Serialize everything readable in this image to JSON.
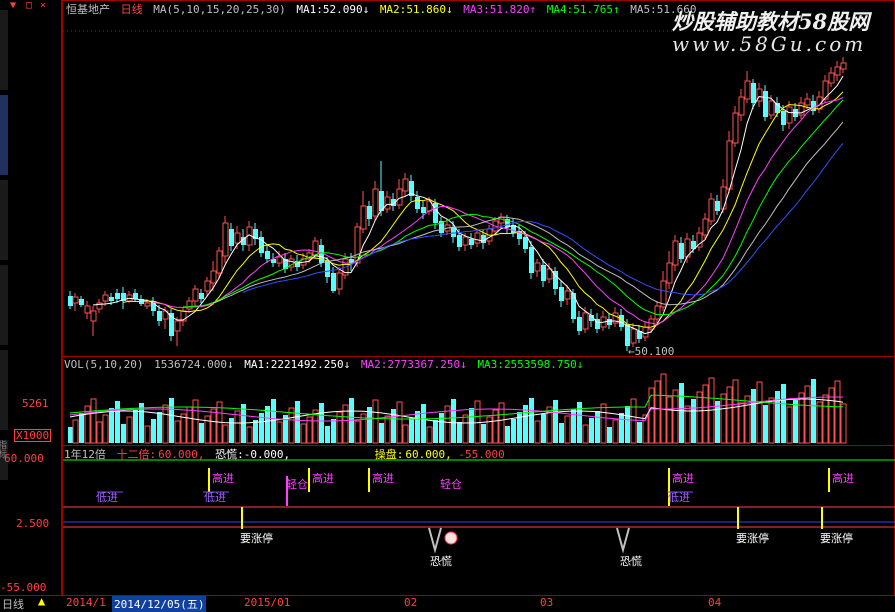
{
  "header": {
    "title": "恒基地产",
    "period": "日线",
    "ma_label": "MA(5,10,15,20,25,30)",
    "ma": [
      {
        "label": "MA1:",
        "value": "52.090↓",
        "color": "#ffffff"
      },
      {
        "label": "MA2:",
        "value": "51.860↓",
        "color": "#ffff00"
      },
      {
        "label": "MA3:",
        "value": "51.820↑",
        "color": "#ff40ff"
      },
      {
        "label": "MA4:",
        "value": "51.765↑",
        "color": "#00ff00"
      },
      {
        "label": "MA5:",
        "value": "51.660",
        "color": "#c0c0c0"
      }
    ]
  },
  "watermark": {
    "line1": "炒股辅助教材58股网",
    "line2": "www.58Gu.com"
  },
  "price_panel": {
    "low_label": "←50.100"
  },
  "vol_panel": {
    "title": "VOL(5,10,20)",
    "vol": "1536724.000↓",
    "ma": [
      {
        "label": "MA1:",
        "value": "2221492.250↓",
        "color": "#ffffff"
      },
      {
        "label": "MA2:",
        "value": "2773367.250↓",
        "color": "#ff40ff"
      },
      {
        "label": "MA3:",
        "value": "2553598.750↓",
        "color": "#00ff00"
      }
    ],
    "axis_value": "5261",
    "axis_unit": "X1000"
  },
  "ind_panel": {
    "title": "1年12倍",
    "f1_label": "十二倍:",
    "f1_value": "60.000,",
    "f2_label": "恐慌:",
    "f2_value": "-0.000,",
    "f3_label": "操盘:",
    "f3_value": "60.000,",
    "f4_value": "-55.000",
    "axis": [
      "60.000",
      "2.500",
      "-55.000"
    ],
    "tags": {
      "gaojin": "高进",
      "zhangting": "要涨停",
      "konghuang": "恐慌",
      "qingcang": "轻仓",
      "dijin": "低进"
    }
  },
  "leftstrip": {
    "ind_label": "指标"
  },
  "statusbar": {
    "period_tab": "日线",
    "ticks": [
      "2014/1",
      "2014/12/05(五)",
      "2015/01",
      "02",
      "03",
      "04"
    ]
  },
  "candles": [
    [
      67,
      295,
      305,
      290,
      308
    ],
    [
      72,
      302,
      296,
      292,
      310
    ],
    [
      78,
      298,
      304,
      295,
      306
    ],
    [
      84,
      312,
      305,
      300,
      318
    ],
    [
      90,
      320,
      310,
      305,
      335
    ],
    [
      96,
      308,
      302,
      298,
      312
    ],
    [
      102,
      300,
      294,
      290,
      305
    ],
    [
      108,
      296,
      300,
      292,
      304
    ],
    [
      114,
      292,
      298,
      288,
      302
    ],
    [
      120,
      292,
      300,
      286,
      308
    ],
    [
      126,
      300,
      294,
      290,
      302
    ],
    [
      132,
      292,
      298,
      288,
      300
    ],
    [
      138,
      298,
      303,
      294,
      305
    ],
    [
      144,
      305,
      302,
      298,
      308
    ],
    [
      150,
      300,
      310,
      296,
      315
    ],
    [
      156,
      310,
      320,
      304,
      325
    ],
    [
      162,
      318,
      310,
      306,
      328
    ],
    [
      168,
      312,
      335,
      308,
      340
    ],
    [
      174,
      330,
      320,
      316,
      345
    ],
    [
      180,
      320,
      310,
      306,
      325
    ],
    [
      186,
      308,
      300,
      296,
      312
    ],
    [
      192,
      300,
      288,
      284,
      305
    ],
    [
      198,
      292,
      298,
      288,
      302
    ],
    [
      204,
      290,
      280,
      276,
      296
    ],
    [
      210,
      282,
      270,
      260,
      290
    ],
    [
      216,
      272,
      250,
      246,
      278
    ],
    [
      222,
      255,
      222,
      215,
      262
    ],
    [
      228,
      228,
      245,
      222,
      250
    ],
    [
      234,
      242,
      232,
      225,
      248
    ],
    [
      240,
      236,
      244,
      228,
      250
    ],
    [
      246,
      244,
      226,
      220,
      250
    ],
    [
      252,
      228,
      238,
      222,
      244
    ],
    [
      258,
      236,
      252,
      230,
      256
    ],
    [
      264,
      250,
      258,
      244,
      262
    ],
    [
      270,
      258,
      262,
      252,
      266
    ],
    [
      276,
      262,
      256,
      250,
      266
    ],
    [
      282,
      258,
      268,
      252,
      272
    ],
    [
      288,
      266,
      258,
      254,
      270
    ],
    [
      294,
      260,
      266,
      254,
      270
    ],
    [
      300,
      264,
      258,
      252,
      268
    ],
    [
      306,
      258,
      252,
      248,
      262
    ],
    [
      312,
      254,
      240,
      236,
      258
    ],
    [
      318,
      244,
      262,
      238,
      266
    ],
    [
      324,
      260,
      276,
      256,
      282
    ],
    [
      330,
      272,
      290,
      266,
      292
    ],
    [
      336,
      288,
      272,
      266,
      294
    ],
    [
      342,
      274,
      258,
      252,
      278
    ],
    [
      348,
      258,
      262,
      252,
      270
    ],
    [
      354,
      262,
      226,
      222,
      266
    ],
    [
      360,
      228,
      205,
      190,
      232
    ],
    [
      366,
      205,
      218,
      200,
      225
    ],
    [
      372,
      215,
      188,
      180,
      220
    ],
    [
      378,
      190,
      210,
      160,
      215
    ],
    [
      384,
      208,
      196,
      190,
      212
    ],
    [
      390,
      198,
      205,
      192,
      210
    ],
    [
      396,
      204,
      188,
      178,
      208
    ],
    [
      402,
      190,
      178,
      172,
      196
    ],
    [
      408,
      180,
      195,
      174,
      200
    ],
    [
      414,
      196,
      208,
      190,
      212
    ],
    [
      420,
      206,
      212,
      200,
      218
    ],
    [
      426,
      210,
      200,
      196,
      214
    ],
    [
      432,
      202,
      222,
      198,
      228
    ],
    [
      438,
      220,
      232,
      216,
      236
    ],
    [
      444,
      230,
      224,
      218,
      234
    ],
    [
      450,
      226,
      236,
      220,
      242
    ],
    [
      456,
      234,
      246,
      228,
      250
    ],
    [
      462,
      244,
      236,
      232,
      250
    ],
    [
      468,
      238,
      244,
      232,
      248
    ],
    [
      474,
      242,
      232,
      228,
      246
    ],
    [
      480,
      234,
      242,
      228,
      248
    ],
    [
      486,
      240,
      228,
      224,
      244
    ],
    [
      492,
      230,
      220,
      216,
      234
    ],
    [
      498,
      222,
      216,
      212,
      228
    ],
    [
      504,
      218,
      226,
      214,
      232
    ],
    [
      510,
      224,
      232,
      218,
      236
    ],
    [
      516,
      230,
      238,
      224,
      244
    ],
    [
      522,
      236,
      248,
      230,
      252
    ],
    [
      528,
      246,
      272,
      240,
      278
    ],
    [
      534,
      270,
      262,
      258,
      276
    ],
    [
      540,
      264,
      280,
      258,
      286
    ],
    [
      546,
      278,
      268,
      262,
      282
    ],
    [
      552,
      270,
      288,
      266,
      294
    ],
    [
      558,
      286,
      300,
      280,
      306
    ],
    [
      564,
      298,
      290,
      284,
      304
    ],
    [
      570,
      292,
      318,
      288,
      322
    ],
    [
      576,
      316,
      330,
      310,
      334
    ],
    [
      582,
      328,
      312,
      306,
      332
    ],
    [
      588,
      314,
      320,
      308,
      326
    ],
    [
      594,
      318,
      328,
      312,
      332
    ],
    [
      600,
      326,
      316,
      310,
      330
    ],
    [
      606,
      318,
      324,
      312,
      328
    ],
    [
      612,
      322,
      312,
      306,
      326
    ],
    [
      618,
      314,
      326,
      308,
      330
    ],
    [
      624,
      324,
      345,
      318,
      350
    ],
    [
      630,
      342,
      328,
      322,
      346
    ],
    [
      636,
      330,
      338,
      324,
      342
    ],
    [
      642,
      336,
      326,
      320,
      340
    ],
    [
      648,
      328,
      318,
      314,
      332
    ],
    [
      654,
      318,
      305,
      300,
      322
    ],
    [
      660,
      306,
      280,
      270,
      310
    ],
    [
      666,
      282,
      262,
      250,
      288
    ],
    [
      672,
      264,
      240,
      234,
      270
    ],
    [
      678,
      242,
      258,
      236,
      262
    ],
    [
      684,
      256,
      238,
      232,
      262
    ],
    [
      690,
      240,
      248,
      234,
      252
    ],
    [
      696,
      246,
      232,
      226,
      250
    ],
    [
      702,
      234,
      218,
      212,
      238
    ],
    [
      708,
      220,
      198,
      192,
      224
    ],
    [
      714,
      200,
      210,
      194,
      214
    ],
    [
      720,
      208,
      186,
      178,
      212
    ],
    [
      726,
      188,
      140,
      130,
      192
    ],
    [
      732,
      142,
      112,
      105,
      146
    ],
    [
      738,
      114,
      96,
      88,
      120
    ],
    [
      744,
      98,
      80,
      70,
      102
    ],
    [
      750,
      82,
      102,
      78,
      108
    ],
    [
      756,
      100,
      88,
      82,
      106
    ],
    [
      762,
      90,
      116,
      84,
      120
    ],
    [
      768,
      114,
      100,
      94,
      118
    ],
    [
      774,
      102,
      112,
      96,
      116
    ],
    [
      780,
      110,
      124,
      104,
      130
    ],
    [
      786,
      122,
      106,
      100,
      128
    ],
    [
      792,
      108,
      116,
      102,
      120
    ],
    [
      798,
      114,
      102,
      96,
      118
    ],
    [
      804,
      104,
      98,
      92,
      108
    ],
    [
      810,
      100,
      110,
      94,
      114
    ],
    [
      816,
      108,
      96,
      90,
      112
    ],
    [
      822,
      98,
      80,
      74,
      102
    ],
    [
      828,
      82,
      72,
      66,
      86
    ],
    [
      834,
      74,
      66,
      60,
      80
    ],
    [
      840,
      68,
      62,
      56,
      72
    ]
  ]
}
